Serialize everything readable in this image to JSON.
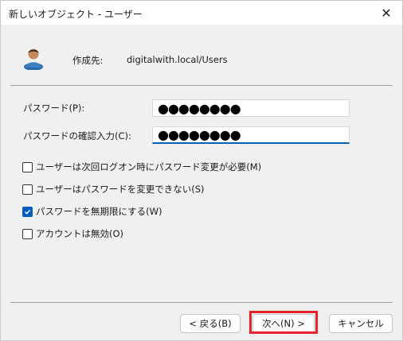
{
  "window": {
    "title": "新しいオブジェクト - ユーザー"
  },
  "header": {
    "create_label": "作成先:",
    "create_path": "digitalwith.local/Users"
  },
  "fields": {
    "password": {
      "label": "パスワード(P):",
      "value": "●●●●●●●●"
    },
    "confirm": {
      "label": "パスワードの確認入力(C):",
      "value": "●●●●●●●●"
    }
  },
  "options": [
    {
      "label": "ユーザーは次回ログオン時にパスワード変更が必要(M)",
      "checked": false
    },
    {
      "label": "ユーザーはパスワードを変更できない(S)",
      "checked": false
    },
    {
      "label": "パスワードを無期限にする(W)",
      "checked": true
    },
    {
      "label": "アカウントは無効(O)",
      "checked": false
    }
  ],
  "buttons": {
    "back": "< 戻る(B)",
    "next": "次へ(N) >",
    "cancel": "キャンセル"
  },
  "icons": {
    "close": "close-icon",
    "user": "user-icon",
    "check": "checkmark-icon"
  },
  "colors": {
    "accent": "#005fb8",
    "highlight": "#e8202a"
  }
}
